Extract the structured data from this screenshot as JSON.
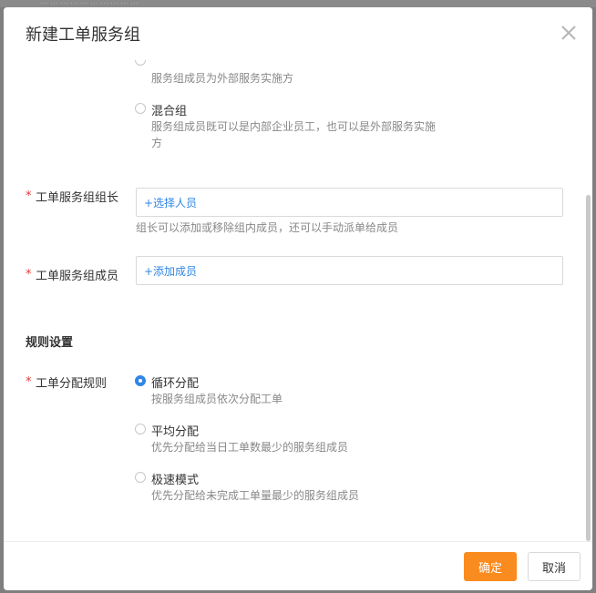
{
  "background": {
    "faint_text": "…………………………"
  },
  "dialog": {
    "title": "新建工单服务组",
    "close_icon": "close-icon"
  },
  "group_type": {
    "options": [
      {
        "label": "",
        "desc": "服务组成员为外部服务实施方",
        "checked": false
      },
      {
        "label": "混合组",
        "desc_line1": "服务组成员既可以是内部企业员工，也可以是外部服务实施",
        "desc_line2": "方",
        "checked": false
      }
    ]
  },
  "fields": {
    "leader": {
      "required": "*",
      "label": "工单服务组组长",
      "action": "+选择人员",
      "hint": "组长可以添加或移除组内成员，还可以手动派单给成员"
    },
    "members": {
      "required": "*",
      "label": "工单服务组成员",
      "action": "+添加成员"
    }
  },
  "rules": {
    "section_title": "规则设置",
    "required": "*",
    "label": "工单分配规则",
    "options": [
      {
        "label": "循环分配",
        "desc": "按服务组成员依次分配工单",
        "checked": true
      },
      {
        "label": "平均分配",
        "desc": "优先分配给当日工单数最少的服务组成员",
        "checked": false
      },
      {
        "label": "极速模式",
        "desc": "优先分配给未完成工单量最少的服务组成员",
        "checked": false
      }
    ]
  },
  "footer": {
    "ok_label": "确定",
    "cancel_label": "取消"
  },
  "colors": {
    "accent": "#2f86e6",
    "primary_button": "#fa8b1e",
    "required": "#e4393c"
  }
}
